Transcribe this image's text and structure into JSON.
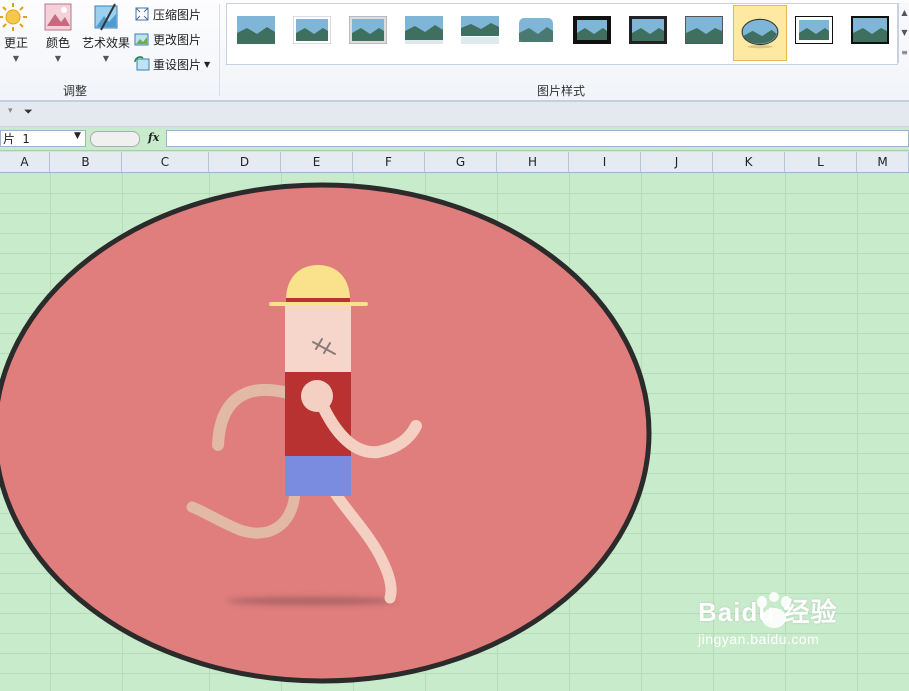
{
  "ribbon": {
    "adjust": {
      "corrections_label": "更正",
      "color_label": "颜色",
      "artistic_label": "艺术效果",
      "compress_label": "压缩图片",
      "change_label": "更改图片",
      "reset_label": "重设图片",
      "group_label": "调整"
    },
    "styles": {
      "group_label": "图片样式",
      "selected_index": 9,
      "thumbnail_count": 12
    }
  },
  "formula_bar": {
    "name_box_value": "片 1",
    "fx_label": "fx",
    "formula_value": ""
  },
  "columns": [
    "A",
    "B",
    "C",
    "D",
    "E",
    "F",
    "G",
    "H",
    "I",
    "J",
    "K",
    "L",
    "M"
  ],
  "picture": {
    "shape": "oval",
    "fill_color": "#e07d7d",
    "border_color": "#2b2b2b",
    "subject": "running-man-illustration"
  },
  "watermark": {
    "brand": "Baidu 经验",
    "url": "jingyan.baidu.com"
  },
  "colors": {
    "sheet_background": "#c8ebcb",
    "gridline": "#b5dcb8",
    "selection_highlight": "#fde9a2"
  }
}
